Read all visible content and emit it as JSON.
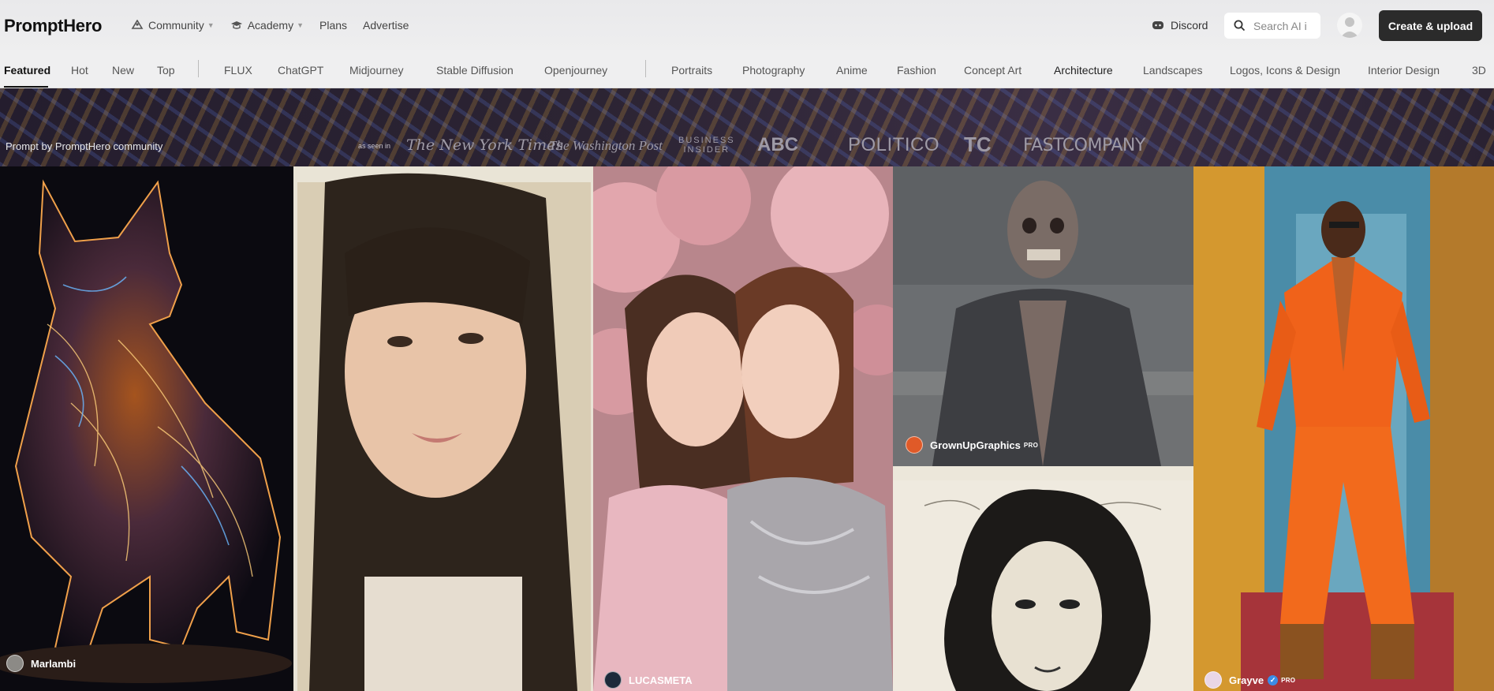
{
  "header": {
    "logo": "PromptHero",
    "nav": [
      {
        "label": "Community",
        "icon": "community-icon",
        "dropdown": true
      },
      {
        "label": "Academy",
        "icon": "graduation-cap-icon",
        "dropdown": true
      },
      {
        "label": "Plans",
        "dropdown": false
      },
      {
        "label": "Advertise",
        "dropdown": false
      }
    ],
    "discord_label": "Discord",
    "search_placeholder": "Search AI i",
    "create_label": "Create & upload"
  },
  "tabs": {
    "feeds": [
      "Featured",
      "Hot",
      "New",
      "Top"
    ],
    "models": [
      "FLUX",
      "ChatGPT",
      "Midjourney",
      "Stable Diffusion",
      "Openjourney"
    ],
    "categories": [
      "Portraits",
      "Photography",
      "Anime",
      "Fashion",
      "Concept Art",
      "Architecture",
      "Landscapes",
      "Logos, Icons & Design",
      "Interior Design",
      "3D"
    ],
    "active": "Featured"
  },
  "banner": {
    "credit": "Prompt by PromptHero community",
    "as_seen_in": "as seen in",
    "press": [
      "The New York Times",
      "The Washington Post",
      "BUSINESS INSIDER",
      "ABC",
      "POLITICO",
      "TC",
      "FASTCOMPANY"
    ]
  },
  "gallery": [
    {
      "subject": "neon fox",
      "author": "Marlambi",
      "pro": false,
      "verified": false
    },
    {
      "subject": "film portrait girl",
      "author": "",
      "pro": false,
      "verified": false
    },
    {
      "subject": "two girls balloons",
      "author": "LUCASMETA",
      "pro": false,
      "verified": false
    },
    {
      "subject": "zombie in suit",
      "author": "GrownUpGraphics",
      "pro": true,
      "verified": false
    },
    {
      "subject": "pencil sketch woman",
      "author": "",
      "pro": false,
      "verified": false
    },
    {
      "subject": "man orange suit",
      "author": "Grayve",
      "pro": true,
      "verified": true
    }
  ],
  "pro_label": "PRO",
  "colors": {
    "create_button": "#2b2b2b",
    "verified": "#3b8ce6",
    "header_bg": "#efeff0"
  }
}
